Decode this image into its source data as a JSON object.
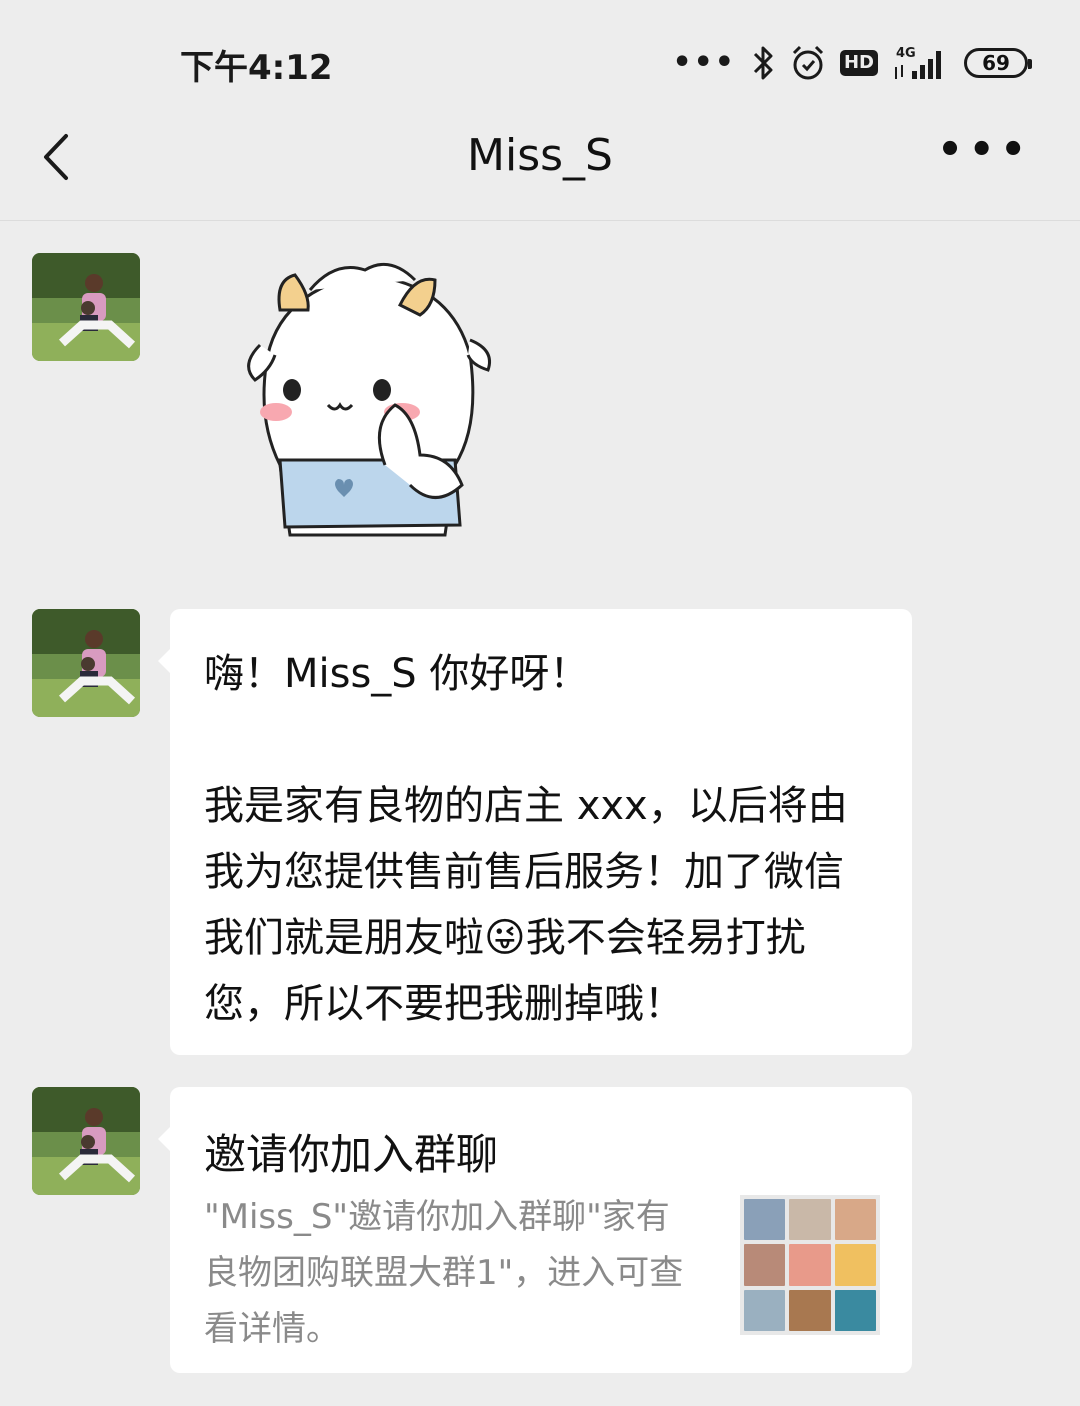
{
  "status_bar": {
    "time": "下午4:12",
    "dots": "•••",
    "hd": "HD",
    "network": "4G",
    "battery": "69"
  },
  "nav": {
    "title": "Miss_S",
    "more": "•••"
  },
  "messages": [
    {
      "type": "sticker",
      "sender_avatar": "avatar-photo",
      "sticker": "white-sheep-cartoon"
    },
    {
      "type": "text",
      "text": "嗨！Miss_S 你好呀！\n\n我是家有良物的店主 xxx，以后将由我为您提供售前售后服务！加了微信我们就是朋友啦😜我不会轻易打扰您，所以不要把我删掉哦！"
    },
    {
      "type": "group_invite",
      "title": "邀请你加入群聊",
      "description": "\"Miss_S\"邀请你加入群聊\"家有良物团购联盟大群1\"，进入可查看详情。"
    }
  ],
  "colors": {
    "background": "#ededed",
    "bubble": "#ffffff",
    "secondary_text": "#8a8a8a"
  }
}
